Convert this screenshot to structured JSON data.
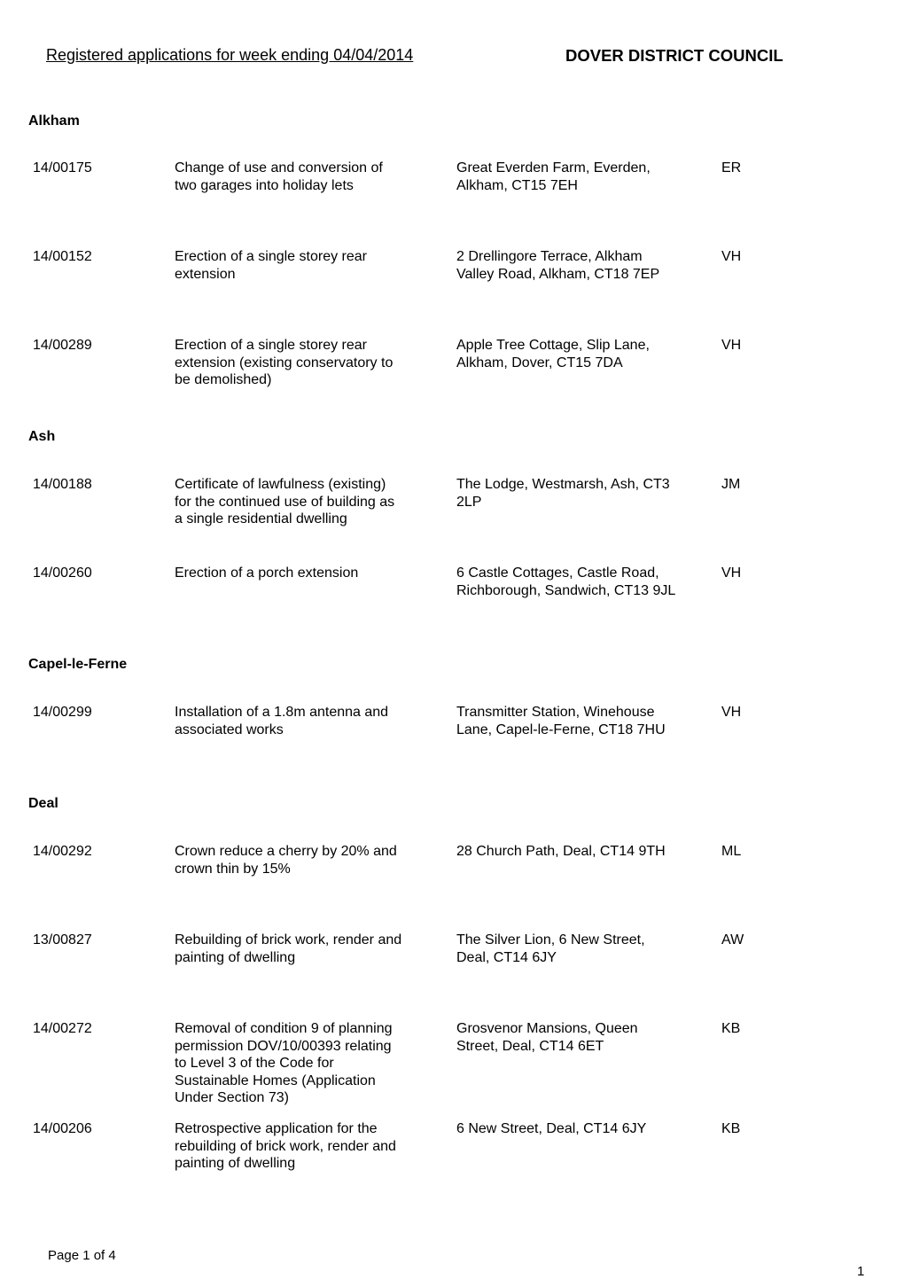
{
  "header": {
    "title": "Registered applications for week ending 04/04/2014",
    "council": "DOVER DISTRICT COUNCIL"
  },
  "sections": [
    {
      "name": "Alkham",
      "applications": [
        {
          "ref": "14/00175",
          "description": "Change of use and conversion of\ntwo garages into holiday lets",
          "address": "Great Everden Farm, Everden,\nAlkham, CT15 7EH",
          "officer": "ER"
        },
        {
          "ref": "14/00152",
          "description": "Erection of a single storey rear\nextension",
          "address": "2 Drellingore Terrace, Alkham\nValley Road, Alkham, CT18 7EP",
          "officer": "VH"
        },
        {
          "ref": "14/00289",
          "description": "Erection of a single storey rear\nextension (existing conservatory to\nbe demolished)",
          "address": "Apple Tree Cottage, Slip Lane,\nAlkham, Dover, CT15 7DA",
          "officer": "VH"
        }
      ]
    },
    {
      "name": "Ash",
      "applications": [
        {
          "ref": "14/00188",
          "description": "Certificate of lawfulness (existing)\nfor the continued use of building as\na single residential dwelling",
          "address": "The Lodge, Westmarsh, Ash, CT3\n2LP",
          "officer": "JM"
        },
        {
          "ref": "14/00260",
          "description": "Erection of a porch extension",
          "address": "6 Castle Cottages, Castle Road,\nRichborough, Sandwich, CT13 9JL",
          "officer": "VH"
        }
      ]
    },
    {
      "name": "Capel-le-Ferne",
      "applications": [
        {
          "ref": "14/00299",
          "description": "Installation of a 1.8m antenna and\nassociated works",
          "address": "Transmitter Station, Winehouse\nLane, Capel-le-Ferne, CT18 7HU",
          "officer": "VH"
        }
      ]
    },
    {
      "name": "Deal",
      "applications": [
        {
          "ref": "14/00292",
          "description": "Crown reduce a cherry by 20% and\ncrown thin by 15%",
          "address": "28 Church Path, Deal, CT14 9TH",
          "officer": "ML"
        },
        {
          "ref": "13/00827",
          "description": "Rebuilding of brick work, render and\npainting of dwelling",
          "address": "The Silver Lion, 6 New Street,\nDeal, CT14 6JY",
          "officer": "AW"
        },
        {
          "ref": "14/00272",
          "description": "Removal of condition 9 of planning\npermission DOV/10/00393 relating\nto Level 3 of the Code for\nSustainable Homes (Application\nUnder Section 73)",
          "address": "Grosvenor Mansions, Queen\nStreet, Deal, CT14 6ET",
          "officer": "KB"
        },
        {
          "ref": "14/00206",
          "description": "Retrospective application for the\nrebuilding of brick work, render and\npainting of dwelling",
          "address": "6 New Street, Deal, CT14 6JY",
          "officer": "KB"
        }
      ]
    }
  ],
  "footer": {
    "page_label": "Page 1 of 4",
    "page_number": "1"
  }
}
